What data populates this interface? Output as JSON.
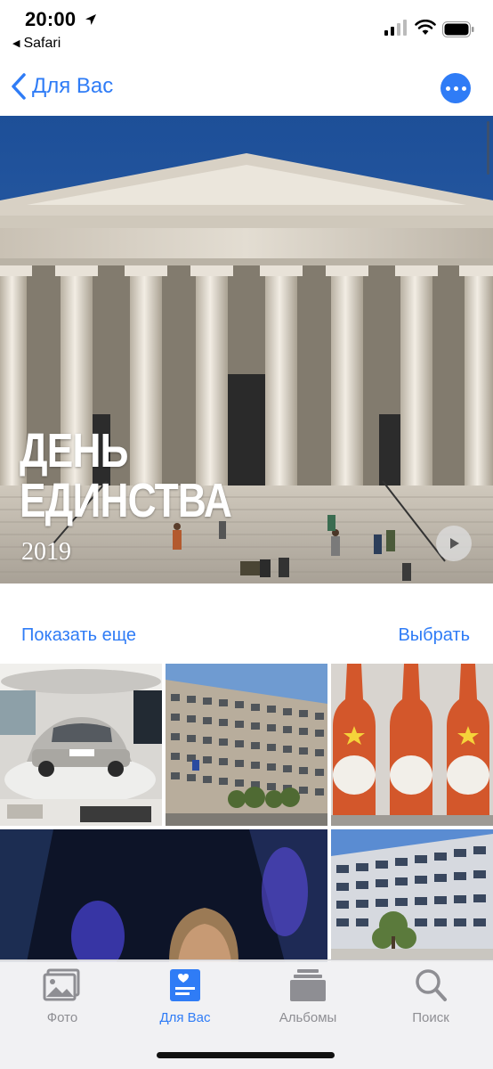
{
  "status_bar": {
    "time": "20:00",
    "back_app": "Safari",
    "icons": [
      "location-arrow-icon",
      "signal-icon",
      "wifi-icon",
      "battery-icon"
    ]
  },
  "nav": {
    "back_label": "Для Вас",
    "more_icon": "ellipsis-icon"
  },
  "memory": {
    "title_line1": "ДЕНЬ",
    "title_line2": "ЕДИНСТВА",
    "year": "2019",
    "play_icon": "play-icon"
  },
  "section": {
    "show_more": "Показать еще",
    "select": "Выбрать"
  },
  "grid": {
    "photos": [
      "car-photo",
      "office-building-photo",
      "bottles-photo",
      "person-photo",
      "tall-building-photo"
    ]
  },
  "tab_bar": {
    "tabs": [
      {
        "label": "Фото",
        "icon": "photos-icon",
        "active": false
      },
      {
        "label": "Для Вас",
        "icon": "for-you-icon",
        "active": true
      },
      {
        "label": "Альбомы",
        "icon": "albums-icon",
        "active": false
      },
      {
        "label": "Поиск",
        "icon": "search-icon",
        "active": false
      }
    ]
  },
  "colors": {
    "accent": "#2f7cf6",
    "inactive_tab": "#8e8e93"
  }
}
